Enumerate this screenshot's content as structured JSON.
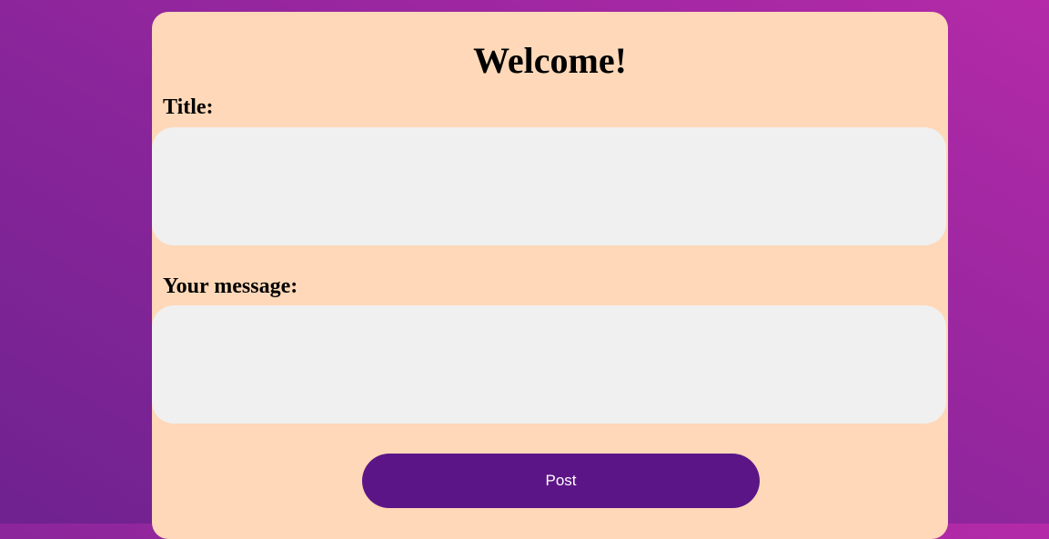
{
  "form": {
    "heading": "Welcome!",
    "title_label": "Title:",
    "title_value": "",
    "message_label": "Your message:",
    "message_value": "",
    "submit_label": "Post"
  },
  "colors": {
    "background_gradient_start": "#6f2290",
    "background_gradient_end": "#b42aa8",
    "card_background": "#fed8b8",
    "field_background": "#f0f0f0",
    "button_background": "#5c1587",
    "button_text": "#ffffff"
  }
}
